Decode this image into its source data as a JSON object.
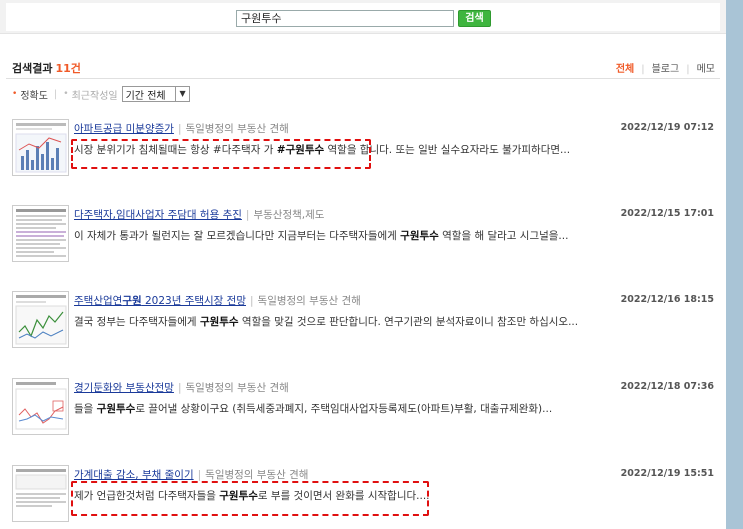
{
  "search": {
    "query": "구원투수",
    "button_label": "검색"
  },
  "results_header": {
    "label": "검색결과",
    "count": "11건"
  },
  "filter_tabs": [
    {
      "label": "전체",
      "active": true
    },
    {
      "label": "블로그",
      "active": false
    },
    {
      "label": "메모",
      "active": false
    }
  ],
  "sort": {
    "accuracy_label": "정확도",
    "recent_label": "최근작성일",
    "period_value": "기간 전체"
  },
  "items": [
    {
      "title_pre": "아파트공급 미분양증가",
      "title_bold": "",
      "title_post": "",
      "category": "독일병정의 부동산 견해",
      "date": "2022/12/19 07:12",
      "snippet_a": "시장 분위기가 침체될때는 항상 #다주택자 가 ",
      "snippet_b": "#구원투수",
      "snippet_c": " 역할을 합니다. 또는 일반 실수요자라도 불가피하다면..."
    },
    {
      "title_pre": "다주택자,임대사업자 주담대 허용 추진",
      "title_bold": "",
      "title_post": "",
      "category": "부동산정책,제도",
      "date": "2022/12/15 17:01",
      "snippet_a": "이 자체가 통과가 될런지는 잘 모르겠습니다만 지금부터는 다주택자들에게 ",
      "snippet_b": "구원투수",
      "snippet_c": " 역할을 해 달라고 시그널을..."
    },
    {
      "title_pre": "주택산업연",
      "title_bold": "구원",
      "title_post": " 2023년 주택시장 전망",
      "category": "독일병정의 부동산 견해",
      "date": "2022/12/16 18:15",
      "snippet_a": "결국 정부는 다주택자들에게 ",
      "snippet_b": "구원투수",
      "snippet_c": " 역할을 맞길 것으로 판단합니다. 연구기관의 분석자료이니 참조만 하십시오..."
    },
    {
      "title_pre": "경기둔화와 부동산전망",
      "title_bold": "",
      "title_post": "",
      "category": "독일병정의 부동산 견해",
      "date": "2022/12/18 07:36",
      "snippet_a": "들을 ",
      "snippet_b": "구원투수",
      "snippet_c": "로 끌어낼 상황이구요 (취득세중과폐지, 주택임대사업자등록제도(아파트)부활, 대출규제완화)..."
    },
    {
      "title_pre": "가계대출 감소, 부채 줄이기",
      "title_bold": "",
      "title_post": "",
      "category": "독일병정의 부동산 견해",
      "date": "2022/12/19 15:51",
      "snippet_a": "제가 언급한것처럼 다주택자들을 ",
      "snippet_b": "구원투수",
      "snippet_c": "로 부를 것이면서 완화를 시작합니다...."
    }
  ],
  "colors": {
    "accent": "#f05a28",
    "link": "#1a3a9a",
    "button": "#3fb53f",
    "highlight": "#e01010"
  }
}
